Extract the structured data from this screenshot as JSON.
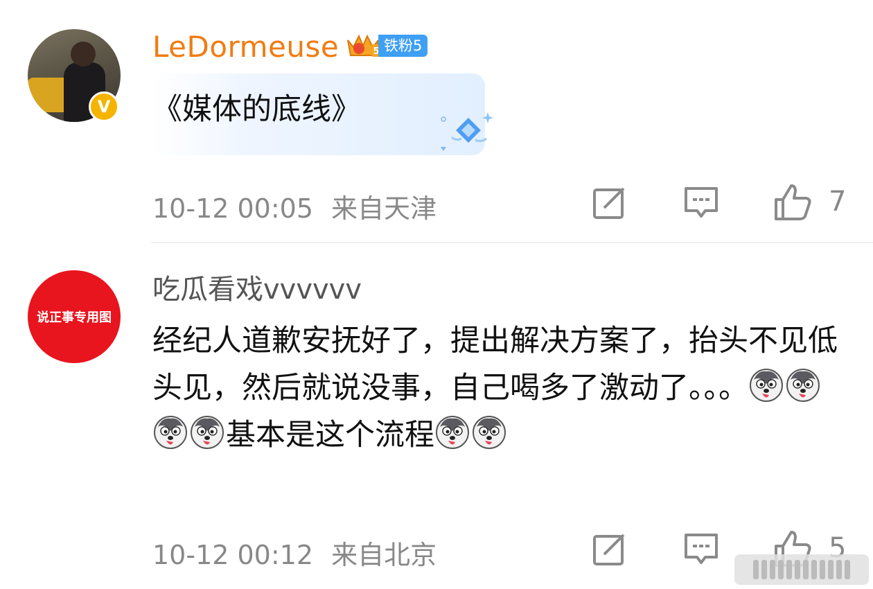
{
  "comments": [
    {
      "avatar": "avatar-photo",
      "username": "LeDormeuse",
      "verified": true,
      "crown_badge_level": "5",
      "fan_badge": "铁粉5",
      "content": "《媒体的底线》",
      "timestamp": "10-12 00:05",
      "location": "来自天津",
      "like_count": "7"
    },
    {
      "avatar_text": "说正事专用图",
      "username": "吃瓜看戏vvvvvv",
      "content_part1": "经纪人道歉安抚好了，提出解决方案了，抬头不见低头见，然后就说没事，自己喝多了激动了。。。",
      "content_part2": "基本是这个流程",
      "timestamp": "10-12 00:12",
      "location": "来自北京",
      "like_count": "5"
    }
  ],
  "colors": {
    "username_vip": "#f07c13",
    "username_normal": "#555555",
    "meta_gray": "#888888",
    "fan_badge": "#3e9ff3",
    "verify_badge": "#f5b400",
    "avatar_red": "#e8141e"
  },
  "icons": [
    "repost-icon",
    "comment-icon",
    "like-icon",
    "husky-emoji-icon",
    "gem-sticker-icon",
    "crown-badge-icon"
  ]
}
